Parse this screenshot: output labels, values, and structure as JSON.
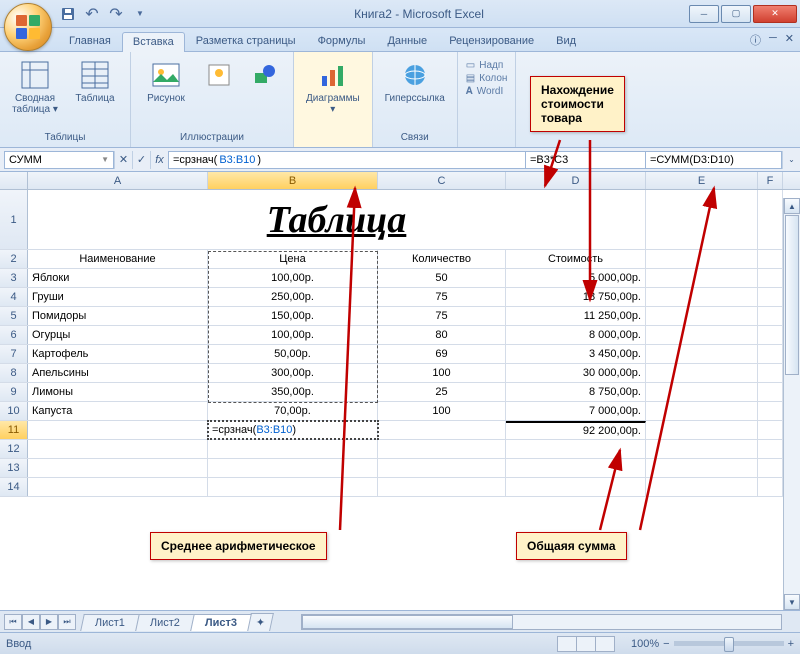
{
  "title": "Книга2 - Microsoft Excel",
  "tabs": [
    "Главная",
    "Вставка",
    "Разметка страницы",
    "Формулы",
    "Данные",
    "Рецензирование",
    "Вид"
  ],
  "active_tab": 1,
  "ribbon": {
    "groups": [
      {
        "label": "Таблицы",
        "items": [
          {
            "label": "Сводная\nтаблица ▾"
          },
          {
            "label": "Таблица"
          }
        ]
      },
      {
        "label": "Иллюстрации",
        "items": [
          {
            "label": "Рисунок"
          },
          {
            "label": ""
          },
          {
            "label": ""
          }
        ]
      },
      {
        "label": "",
        "items": [
          {
            "label": "Диаграммы\n▾"
          }
        ]
      },
      {
        "label": "Связи",
        "items": [
          {
            "label": "Гиперссылка"
          }
        ]
      },
      {
        "small": [
          "Надп",
          "Колон",
          "WordI"
        ]
      }
    ]
  },
  "namebox": "СУММ",
  "formula_main": "=срзнач(B3:B10)",
  "formula_parts": {
    "prefix": "=срзнач(",
    "ref": "B3:B10",
    "suffix": ")"
  },
  "formula_extra1": "=B3*C3",
  "formula_extra2": "=СУММ(D3:D10)",
  "cols": [
    "A",
    "B",
    "C",
    "D",
    "E",
    "F"
  ],
  "table_title": "Таблица",
  "headers": [
    "Наименование",
    "Цена",
    "Количество",
    "Стоимость"
  ],
  "rows": [
    {
      "n": "Яблоки",
      "p": "100,00р.",
      "q": "50",
      "c": "5 000,00р."
    },
    {
      "n": "Груши",
      "p": "250,00р.",
      "q": "75",
      "c": "18 750,00р."
    },
    {
      "n": "Помидоры",
      "p": "150,00р.",
      "q": "75",
      "c": "11 250,00р."
    },
    {
      "n": "Огурцы",
      "p": "100,00р.",
      "q": "80",
      "c": "8 000,00р."
    },
    {
      "n": "Картофель",
      "p": "50,00р.",
      "q": "69",
      "c": "3 450,00р."
    },
    {
      "n": "Апельсины",
      "p": "300,00р.",
      "q": "100",
      "c": "30 000,00р."
    },
    {
      "n": "Лимоны",
      "p": "350,00р.",
      "q": "25",
      "c": "8 750,00р."
    },
    {
      "n": "Капуста",
      "p": "70,00р.",
      "q": "100",
      "c": "7 000,00р."
    }
  ],
  "edit_cell": "=срзнач(B3:B10)",
  "edit_parts": {
    "prefix": "=срзнач(",
    "ref": "B3:B10",
    "suffix": ")"
  },
  "total": "92 200,00р.",
  "sheets": [
    "Лист1",
    "Лист2",
    "Лист3"
  ],
  "active_sheet": 2,
  "status": "Ввод",
  "zoom": "100%",
  "callouts": {
    "top": "Нахождение\nстоимости\nтовара",
    "left": "Среднее арифметическое",
    "right": "Общаяя сумма"
  }
}
